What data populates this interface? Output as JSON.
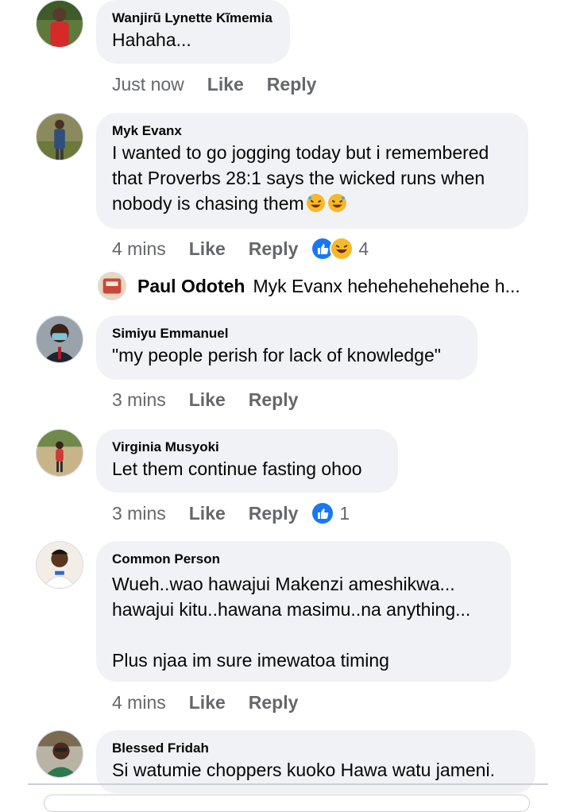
{
  "comments": [
    {
      "author": "Wanjirũ Lynette Kĩmemia",
      "lines": [
        "Hahaha..."
      ],
      "time": "Just now",
      "like_label": "Like",
      "reply_label": "Reply",
      "reaction_count": ""
    },
    {
      "author": "Myk Evanx",
      "lines": [
        "I wanted to go jogging today but i remembered",
        "that Proverbs 28:1 says the wicked runs when",
        "nobody is chasing them"
      ],
      "time": "4 mins",
      "like_label": "Like",
      "reply_label": "Reply",
      "reaction_count": "4"
    },
    {
      "author": "Simiyu Emmanuel",
      "lines": [
        "\"my people perish for lack of knowledge\""
      ],
      "time": "3 mins",
      "like_label": "Like",
      "reply_label": "Reply",
      "reaction_count": ""
    },
    {
      "author": "Virginia Musyoki",
      "lines": [
        "Let them continue fasting ohoo"
      ],
      "time": "3 mins",
      "like_label": "Like",
      "reply_label": "Reply",
      "reaction_count": "1"
    },
    {
      "author": "Common Person",
      "lines": [
        "Wueh..wao hawajui Makenzi ameshikwa...",
        "hawajui kitu..hawana masimu..na anything...",
        "",
        "Plus njaa im sure imewatoa timing"
      ],
      "time": "4 mins",
      "like_label": "Like",
      "reply_label": "Reply",
      "reaction_count": ""
    },
    {
      "author": "Blessed Fridah",
      "lines": [
        "Si watumie choppers kuoko Hawa watu jameni."
      ]
    }
  ],
  "reply_preview": {
    "author": "Paul Odoteh",
    "text": "Myk Evanx hehehehehehehe h..."
  },
  "icons": {
    "like": "like-thumb-icon",
    "haha": "haha-emoji-icon",
    "laugh_emoji": "rolling-laughing-emoji"
  },
  "colors": {
    "bubble": "#f0f2f5",
    "meta_text": "#65676b",
    "like_blue": "#1877f2",
    "haha_yellow": "#f7b928"
  }
}
